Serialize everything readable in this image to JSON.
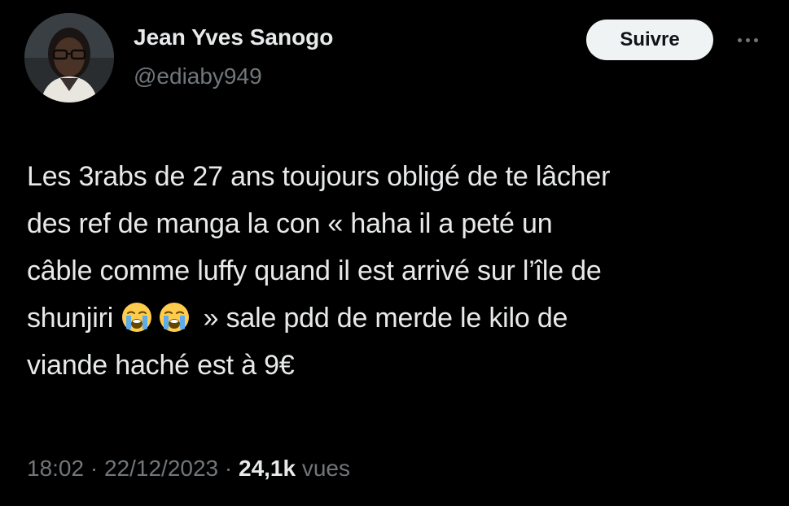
{
  "author": {
    "display_name": "Jean Yves Sanogo",
    "handle": "@ediaby949"
  },
  "header": {
    "follow_label": "Suivre",
    "more_icon": "more-horizontal-icon"
  },
  "tweet": {
    "lines": [
      "Les 3rabs de 27 ans toujours obligé de te lâcher",
      "des ref de manga la con « haha il a peté un",
      "câble comme luffy quand il est arrivé sur l’île de",
      "shunjiri",
      "» sale pdd de merde le kilo de",
      "viande haché est à 9€"
    ],
    "emoji_icon": "loudly-crying-face-icon"
  },
  "meta": {
    "time": "18:02",
    "separator": "·",
    "date": "22/12/2023",
    "views_count": "24,1k",
    "views_label": "vues"
  },
  "colors": {
    "background": "#000000",
    "primary_text": "#e7e9ea",
    "secondary_text": "#71767b",
    "follow_button_bg": "#eff3f4",
    "follow_button_text": "#0f1419"
  }
}
